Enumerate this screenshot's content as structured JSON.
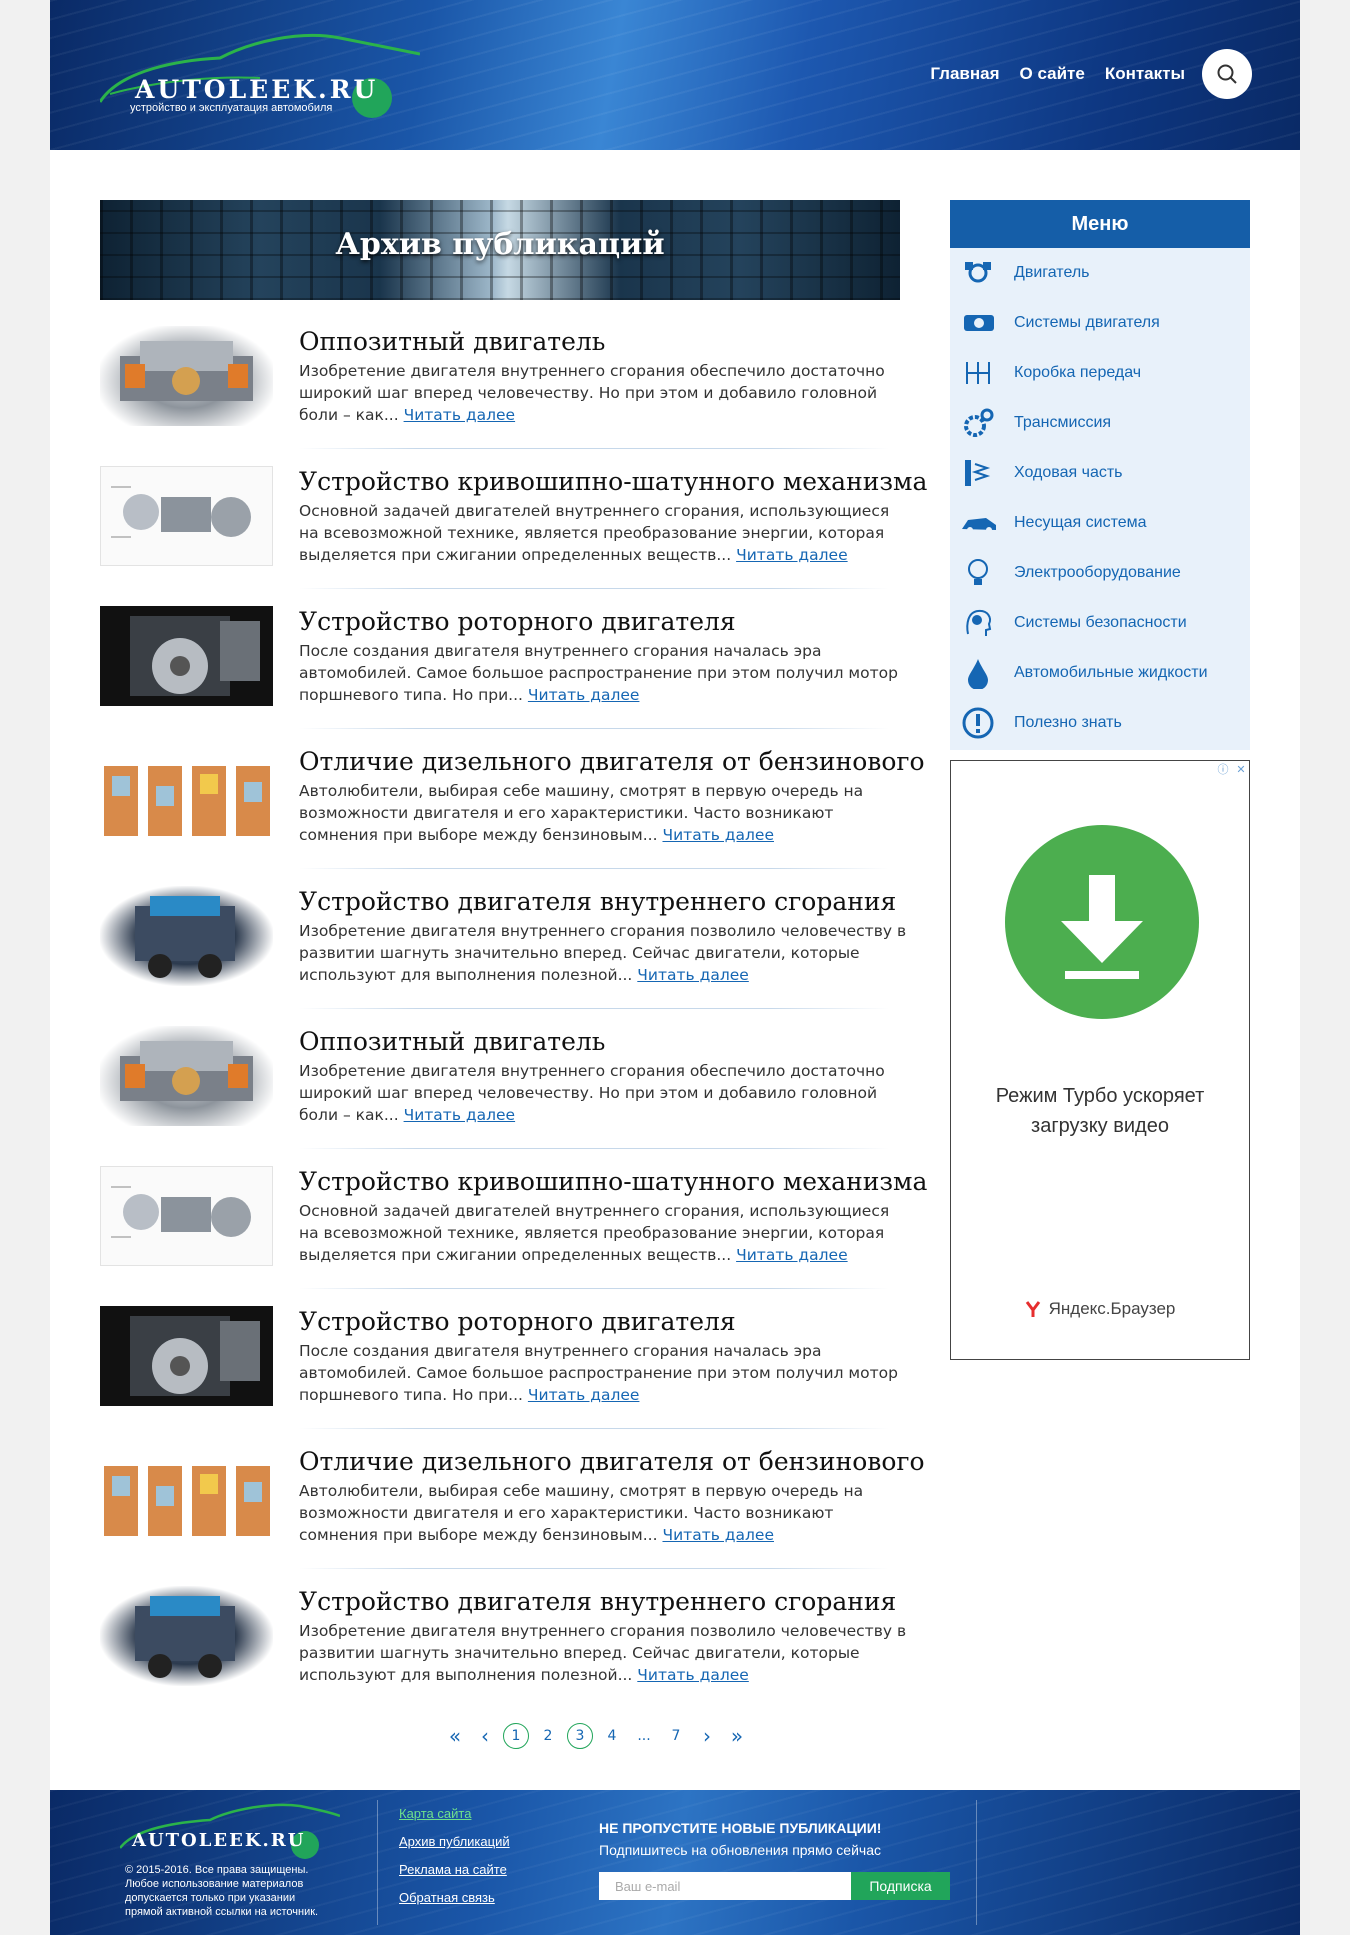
{
  "header": {
    "logo_text": "AUTOLEEK.RU",
    "logo_tagline": "устройство и эксплуатация автомобиля",
    "nav": [
      "Главная",
      "О сайте",
      "Контакты"
    ]
  },
  "banner": {
    "title": "Архив публикаций"
  },
  "read_more": "Читать далее",
  "articles": [
    {
      "title": "Оппозитный двигатель",
      "excerpt": "Изобретение двигателя внутреннего сгорания обеспечило достаточно широкий шаг вперед человечеству. Но при этом и добавило головной боли – как...",
      "thumb": "boxer-engine"
    },
    {
      "title": "Устройство кривошипно-шатунного механизма",
      "excerpt": "Основной задачей двигателей внутреннего сгорания, использующиеся на всевозможной технике, является преобразование энергии, которая выделяется при сжигании определенных веществ...",
      "thumb": "crank-diagram"
    },
    {
      "title": "Устройство роторного двигателя",
      "excerpt": "После создания двигателя внутреннего сгорания началась эра автомобилей. Самое большое распространение при этом получил мотор поршневого типа. Но при...",
      "thumb": "rotary-engine"
    },
    {
      "title": "Отличие дизельного двигателя от бензинового",
      "excerpt": "Автолюбители, выбирая себе машину, смотрят в первую очередь на возможности двигателя и его характеристики. Часто возникают сомнения при выборе между бензиновым...",
      "thumb": "diesel-strokes"
    },
    {
      "title": "Устройство двигателя внутреннего сгорания",
      "excerpt": "Изобретение двигателя внутреннего сгорания позволило человечеству в развитии шагнуть значительно вперед. Сейчас двигатели, которые используют для выполнения полезной...",
      "thumb": "v6-engine"
    },
    {
      "title": "Оппозитный двигатель",
      "excerpt": "Изобретение двигателя внутреннего сгорания обеспечило достаточно широкий шаг вперед человечеству. Но при этом и добавило головной боли – как...",
      "thumb": "boxer-engine"
    },
    {
      "title": "Устройство кривошипно-шатунного механизма",
      "excerpt": "Основной задачей двигателей внутреннего сгорания, использующиеся на всевозможной технике, является преобразование энергии, которая выделяется при сжигании определенных веществ...",
      "thumb": "crank-diagram"
    },
    {
      "title": "Устройство роторного двигателя",
      "excerpt": "После создания двигателя внутреннего сгорания началась эра автомобилей. Самое большое распространение при этом получил мотор поршневого типа. Но при...",
      "thumb": "rotary-engine"
    },
    {
      "title": "Отличие дизельного двигателя от бензинового",
      "excerpt": "Автолюбители, выбирая себе машину, смотрят в первую очередь на возможности двигателя и его характеристики. Часто возникают сомнения при выборе между бензиновым...",
      "thumb": "diesel-strokes"
    },
    {
      "title": "Устройство двигателя внутреннего сгорания",
      "excerpt": "Изобретение двигателя внутреннего сгорания позволило человечеству в развитии шагнуть значительно вперед. Сейчас двигатели, которые используют для выполнения полезной...",
      "thumb": "v6-engine"
    }
  ],
  "pagination": {
    "first": "«",
    "prev": "‹",
    "next": "›",
    "last": "»",
    "pages": [
      "1",
      "2",
      "3",
      "4",
      "...",
      "7"
    ],
    "current": "3",
    "circled": [
      "1",
      "3"
    ]
  },
  "menu": {
    "title": "Меню",
    "items": [
      {
        "label": "Двигатель",
        "icon": "engine-icon"
      },
      {
        "label": "Системы двигателя",
        "icon": "engine-block-icon"
      },
      {
        "label": "Коробка передач",
        "icon": "gearbox-icon"
      },
      {
        "label": "Трансмиссия",
        "icon": "gears-icon"
      },
      {
        "label": "Ходовая часть",
        "icon": "suspension-icon"
      },
      {
        "label": "Несущая система",
        "icon": "car-body-icon"
      },
      {
        "label": "Электрооборудование",
        "icon": "lightbulb-icon"
      },
      {
        "label": "Системы безопасности",
        "icon": "safety-head-icon"
      },
      {
        "label": "Автомобильные жидкости",
        "icon": "drop-icon"
      },
      {
        "label": "Полезно знать",
        "icon": "exclamation-icon"
      }
    ]
  },
  "ad": {
    "text_line1": "Режим Турбо ускоряет",
    "text_line2": "загрузку видео",
    "brand": "Яндекс.Браузер"
  },
  "footer": {
    "logo_text": "AUTOLEEK.RU",
    "copyright": "© 2015-2016. Все права защищены. Любое использование материалов допускается только при указании прямой активной ссылки на источник.",
    "links": [
      "Карта сайта",
      "Архив публикаций",
      "Реклама на сайте",
      "Обратная связь"
    ],
    "subscribe_title": "НЕ ПРОПУСТИТЕ НОВЫЕ ПУБЛИКАЦИИ!",
    "subscribe_text": "Подпишитесь на обновления прямо сейчас",
    "email_placeholder": "Ваш e-mail",
    "subscribe_button": "Подписка"
  },
  "colors": {
    "brand_blue": "#155ea8",
    "link": "#1566b3",
    "accent_green": "#21a55a"
  }
}
